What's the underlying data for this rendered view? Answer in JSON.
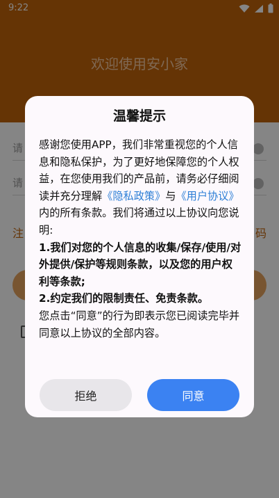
{
  "status_bar": {
    "time": "9:22"
  },
  "background": {
    "app_title": "欢迎使用安小家",
    "phone_placeholder": "请",
    "password_placeholder": "请",
    "register_link": "注",
    "forgot_link": "码"
  },
  "dialog": {
    "title": "温馨提示",
    "body": {
      "intro": "感谢您使用APP，我们非常重视您的个人信息和隐私保护，为了更好地保障您的个人权益，在您使用我们的产品前，请务必仔细阅读并充分理解",
      "privacy_link": "《隐私政策》",
      "and": "与",
      "agreement_link": "《用户协议》",
      "after_links": "内的所有条款。我们将通过以上协议向您说明:",
      "point1": "1.我们对您的个人信息的收集/保存/使用/对外提供/保护等规则条款，以及您的用户权利等条款;",
      "point2": "2.约定我们的限制责任、免责条款。",
      "outro": "您点击“同意”的行为即表示您已阅读完毕并同意以上协议的全部内容。"
    },
    "reject_label": "拒绝",
    "agree_label": "同意"
  },
  "colors": {
    "brand": "#c2640b",
    "link": "#2d7fd6",
    "agree_button": "#3b82f2"
  },
  "icons": {
    "status": [
      "wifi-icon",
      "signal-icon",
      "battery-icon"
    ]
  }
}
